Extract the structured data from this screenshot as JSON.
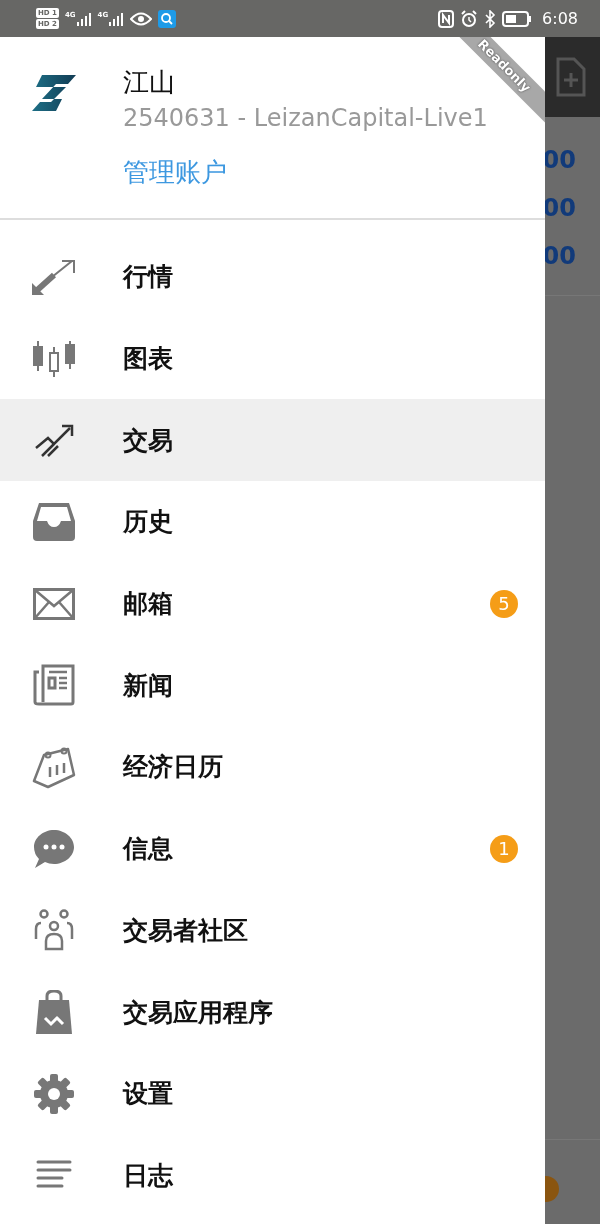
{
  "status_bar": {
    "time": "6:08",
    "sim_labels": [
      "HD 1",
      "HD 2"
    ],
    "network_labels": [
      "4G",
      "4G"
    ]
  },
  "account": {
    "name": "江山",
    "server": "2540631 - LeizanCapital-Live1",
    "manage_link": "管理账户",
    "ribbon": "Readonly"
  },
  "menu": [
    {
      "label": "行情",
      "selected": false
    },
    {
      "label": "图表",
      "selected": false
    },
    {
      "label": "交易",
      "selected": true
    },
    {
      "label": "历史",
      "selected": false
    },
    {
      "label": "邮箱",
      "selected": false,
      "badge": "5"
    },
    {
      "label": "新闻",
      "selected": false
    },
    {
      "label": "经济日历",
      "selected": false
    },
    {
      "label": "信息",
      "selected": false,
      "badge": "1"
    },
    {
      "label": "交易者社区",
      "selected": false
    },
    {
      "label": "交易应用程序",
      "selected": false
    },
    {
      "label": "设置",
      "selected": false
    },
    {
      "label": "日志",
      "selected": false
    }
  ],
  "background_values": [
    "00",
    "00",
    "00"
  ]
}
